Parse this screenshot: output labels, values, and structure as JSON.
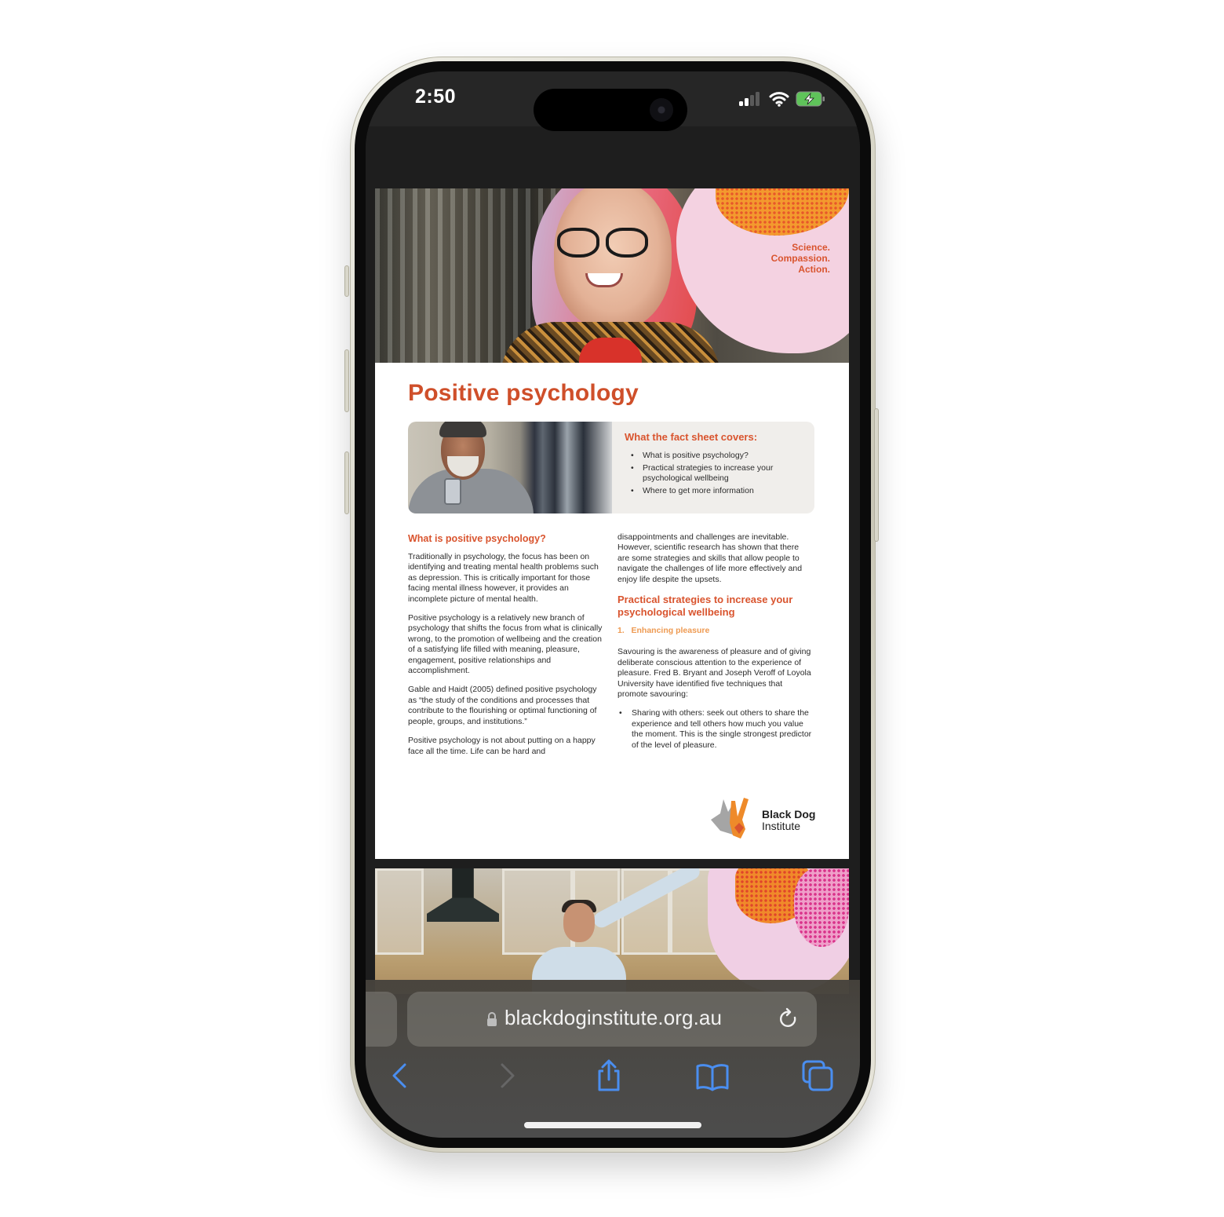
{
  "status_bar": {
    "time": "2:50",
    "signal_bars_active": 2,
    "signal_bars_total": 4,
    "wifi": "wifi-icon",
    "battery": "battery-charging-icon",
    "battery_color": "#5fc35a"
  },
  "document": {
    "hero": {
      "tagline": [
        "Science.",
        "Compassion.",
        "Action."
      ]
    },
    "title": "Positive psychology",
    "cover_card": {
      "title": "What the fact sheet covers:",
      "items": [
        "What is positive psychology?",
        "Practical strategies to increase your psychological wellbeing",
        "Where to get more information"
      ]
    },
    "left_column": {
      "heading": "What is positive psychology?",
      "paragraphs": [
        "Traditionally in psychology, the focus has been on identifying and treating mental health problems such as depression. This is critically important for those facing mental illness however, it provides an incomplete picture of mental health.",
        "Positive psychology is a relatively new branch of psychology that shifts the focus from what is clinically wrong, to the promotion of wellbeing and the creation of a satisfying life filled with meaning, pleasure, engagement, positive relationships and accomplishment.",
        "Gable and Haidt (2005) defined positive psychology as “the study of the conditions and processes that contribute to the flourishing or optimal functioning of people, groups, and institutions.”",
        "Positive psychology is not about putting on a happy face all the time. Life can be hard and"
      ]
    },
    "right_column": {
      "continued_paragraph": "disappointments and challenges are inevitable. However, scientific research has shown that there are some strategies and skills that allow people to navigate the challenges of life more effectively and enjoy life despite the upsets.",
      "heading": "Practical strategies to increase your psychological wellbeing",
      "subheading": "1.   Enhancing pleasure",
      "paragraph": "Savouring is the awareness of pleasure and of giving deliberate conscious attention to the experience of pleasure. Fred B. Bryant and Joseph Veroff of Loyola University have identified five techniques that promote savouring:",
      "bullets": [
        "Sharing with others: seek out others to share the experience and tell others how much you value the moment. This is the single strongest predictor of the level of pleasure."
      ]
    },
    "logo": {
      "line1": "Black Dog",
      "line2": "Institute"
    },
    "colors": {
      "brand_orange": "#d9542e",
      "subheading_orange": "#ee9a52",
      "card_bg": "#f0eeeb",
      "blob_pink": "#f4d2e1"
    }
  },
  "safari": {
    "url": "blackdoginstitute.org.au",
    "accent": "#4a8ef0",
    "toolbar": {
      "back": "back-icon",
      "forward": "forward-icon",
      "share": "share-icon",
      "bookmarks": "bookmarks-icon",
      "tabs": "tabs-icon"
    }
  }
}
